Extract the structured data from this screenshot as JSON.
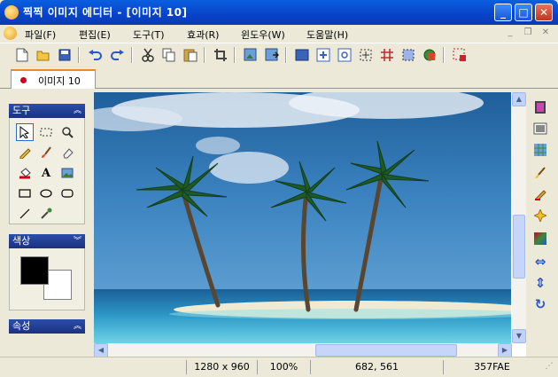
{
  "window": {
    "title": "찍찍 이미지 에디터 - [이미지 10]"
  },
  "menubar": [
    {
      "label": "파일(F)"
    },
    {
      "label": "편집(E)"
    },
    {
      "label": "도구(T)"
    },
    {
      "label": "효과(R)"
    },
    {
      "label": "윈도우(W)"
    },
    {
      "label": "도움말(H)"
    }
  ],
  "tab": {
    "label": "이미지 10"
  },
  "panels": {
    "tools": {
      "title": "도구"
    },
    "colors": {
      "title": "색상",
      "foreground": "#000000",
      "background": "#ffffff"
    },
    "properties": {
      "title": "속성"
    }
  },
  "statusbar": {
    "dimensions": "1280 x 960",
    "zoom": "100%",
    "cursor": "682, 561",
    "color": "357FAE"
  },
  "colors": {
    "title_blue": "#0842c8",
    "accent_orange": "#e68b2c"
  }
}
